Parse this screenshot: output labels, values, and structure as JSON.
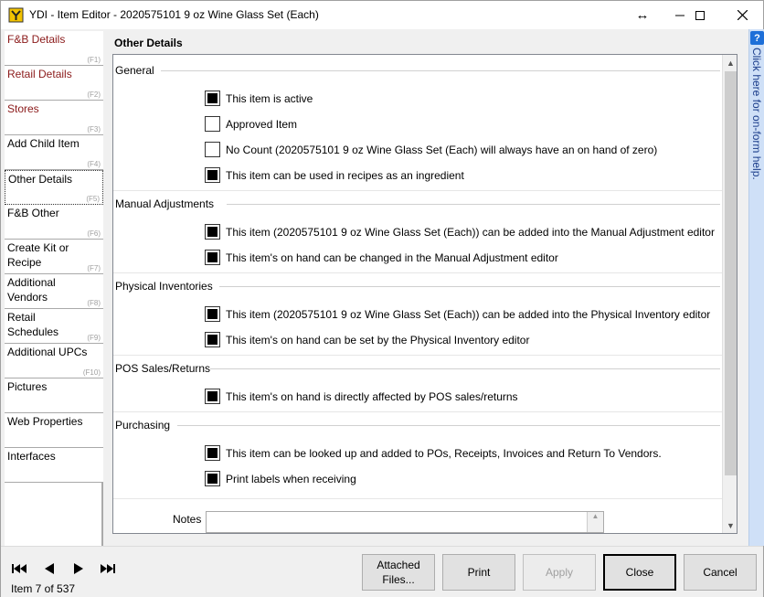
{
  "window": {
    "title": "YDI - Item Editor - 2020575101 9 oz Wine Glass Set (Each)",
    "controls": {
      "resize": "↔",
      "minimize": "—",
      "maximize": "☐",
      "close": "✕"
    }
  },
  "nav": {
    "items": [
      {
        "label": "F&B Details",
        "key": "(F1)"
      },
      {
        "label": "Retail Details",
        "key": "(F2)"
      },
      {
        "label": "Stores",
        "key": "(F3)"
      },
      {
        "label": "Add Child Item",
        "key": "(F4)"
      },
      {
        "label": "Other Details",
        "key": "(F5)"
      },
      {
        "label": "F&B Other",
        "key": "(F6)"
      },
      {
        "label": "Create Kit or Recipe",
        "key": "(F7)"
      },
      {
        "label": "Additional Vendors",
        "key": "(F8)"
      },
      {
        "label": "Retail Schedules",
        "key": "(F9)"
      },
      {
        "label": "Additional UPCs",
        "key": "(F10)"
      },
      {
        "label": "Pictures",
        "key": ""
      },
      {
        "label": "Web Properties",
        "key": ""
      },
      {
        "label": "Interfaces",
        "key": ""
      }
    ]
  },
  "panel": {
    "title": "Other Details",
    "sections": [
      {
        "header": "General",
        "options": [
          {
            "label": "This item is active",
            "checked": true
          },
          {
            "label": "Approved Item",
            "checked": false
          },
          {
            "label": "No Count (2020575101 9 oz Wine Glass Set (Each) will always have an on hand of zero)",
            "checked": false
          },
          {
            "label": "This item can be used in recipes as an ingredient",
            "checked": true
          }
        ]
      },
      {
        "header": "Manual Adjustments",
        "options": [
          {
            "label": "This item (2020575101 9 oz Wine Glass Set (Each)) can be added into the Manual Adjustment editor",
            "checked": true
          },
          {
            "label": "This item's on hand can be changed in the Manual Adjustment editor",
            "checked": true
          }
        ]
      },
      {
        "header": "Physical Inventories",
        "options": [
          {
            "label": "This item (2020575101 9 oz Wine Glass Set (Each)) can be added into the Physical Inventory editor",
            "checked": true
          },
          {
            "label": "This item's on hand can be set by the Physical Inventory editor",
            "checked": true
          }
        ]
      },
      {
        "header": "POS Sales/Returns",
        "options": [
          {
            "label": "This item's on hand is directly affected by POS sales/returns",
            "checked": true
          }
        ]
      },
      {
        "header": "Purchasing",
        "options": [
          {
            "label": "This item can be looked up and added to POs, Receipts, Invoices and Return To Vendors.",
            "checked": true
          },
          {
            "label": "Print labels when receiving",
            "checked": true
          }
        ]
      }
    ],
    "notes_label": "Notes",
    "notes_value": ""
  },
  "help": {
    "text": "Click here for on-form help."
  },
  "bottom": {
    "item_count": "Item 7 of 537",
    "buttons": {
      "attached_files": "Attached Files...",
      "print": "Print",
      "apply": "Apply",
      "close": "Close",
      "cancel": "Cancel"
    }
  }
}
